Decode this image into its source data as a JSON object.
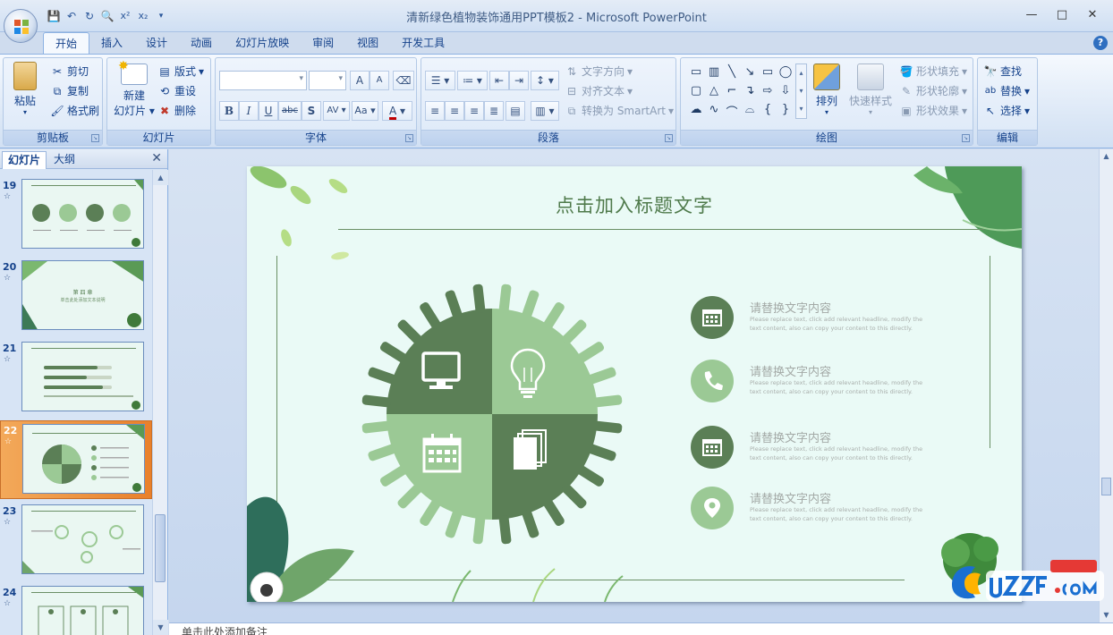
{
  "window": {
    "title": "清新绿色植物装饰通用PPT模板2 - Microsoft PowerPoint",
    "controls": [
      "—",
      "□",
      "✕"
    ]
  },
  "ribbon_tabs": [
    "开始",
    "插入",
    "设计",
    "动画",
    "幻灯片放映",
    "审阅",
    "视图",
    "开发工具"
  ],
  "clipboard": {
    "paste": "粘贴",
    "cut": "剪切",
    "copy": "复制",
    "format_painter": "格式刷",
    "label": "剪贴板"
  },
  "slides_group": {
    "new_slide_line1": "新建",
    "new_slide_line2": "幻灯片",
    "layout": "版式",
    "reset": "重设",
    "delete": "删除",
    "label": "幻灯片"
  },
  "font_group": {
    "label": "字体",
    "buttons": [
      "B",
      "I",
      "U",
      "abc",
      "S",
      "AV",
      "Aa",
      "A"
    ],
    "grow": "A",
    "shrink": "A"
  },
  "paragraph_group": {
    "label": "段落",
    "text_direction": "文字方向",
    "align_text": "对齐文本",
    "convert_smartart": "转换为 SmartArt"
  },
  "drawing_group": {
    "label": "绘图",
    "arrange": "排列",
    "quick_styles": "快速样式",
    "shape_fill": "形状填充",
    "shape_outline": "形状轮廓",
    "shape_effects": "形状效果"
  },
  "editing_group": {
    "label": "编辑",
    "find": "查找",
    "replace": "替换",
    "select": "选择"
  },
  "left_panel": {
    "tab_slides": "幻灯片",
    "tab_outline": "大纲",
    "slides": [
      {
        "number": "19",
        "selected": false
      },
      {
        "number": "20",
        "selected": false,
        "text1": "第 四 章",
        "text2": "单击此处添加文本说明"
      },
      {
        "number": "21",
        "selected": false
      },
      {
        "number": "22",
        "selected": true
      },
      {
        "number": "23",
        "selected": false
      },
      {
        "number": "24",
        "selected": false
      }
    ]
  },
  "slide": {
    "title": "点击加入标题文字",
    "items": [
      {
        "title": "请替换文字内容",
        "desc": "Please replace text, click add relevant headline, modify the text content, also can copy your content to this directly.",
        "icon": "calendar-icon",
        "color": "#5b7f56"
      },
      {
        "title": "请替换文字内容",
        "desc": "Please replace text, click add relevant headline, modify the text content, also can copy your content to this directly.",
        "icon": "phone-icon",
        "color": "#9bc995"
      },
      {
        "title": "请替换文字内容",
        "desc": "Please replace text, click add relevant headline, modify the text content, also can copy your content to this directly.",
        "icon": "calendar-icon",
        "color": "#5b7f56"
      },
      {
        "title": "请替换文字内容",
        "desc": "Please replace text, click add relevant headline, modify the text content, also can copy your content to this directly.",
        "icon": "location-pin-icon",
        "color": "#9bc995"
      }
    ],
    "gear_colors": {
      "dark": "#5b7f56",
      "light": "#9bc995"
    }
  },
  "notes": {
    "placeholder": "单击此处添加备注"
  }
}
